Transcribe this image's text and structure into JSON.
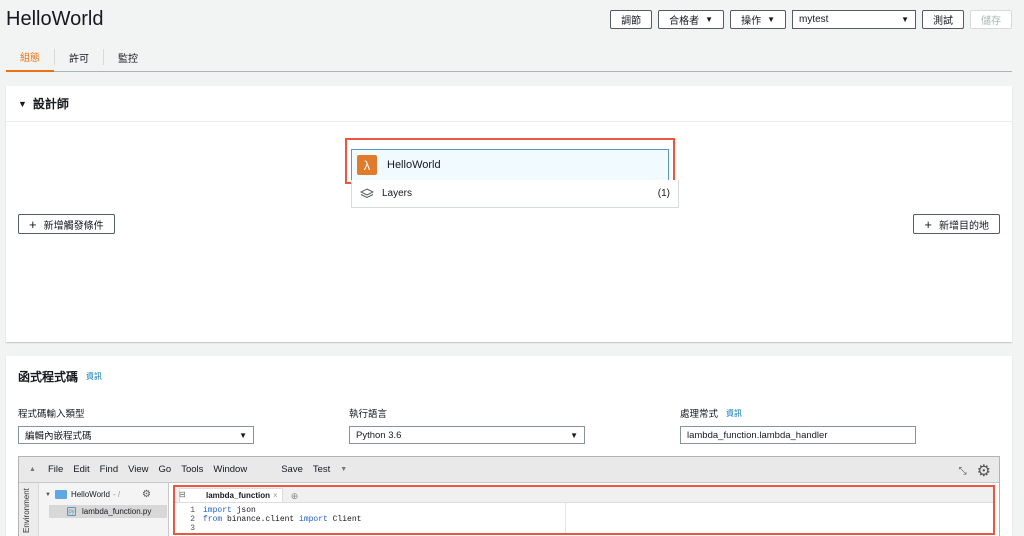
{
  "page": {
    "title": "HelloWorld"
  },
  "top_actions": {
    "throttle": "調節",
    "qualifiers": "合格者",
    "actions": "操作",
    "test_event_select": "mytest",
    "test": "測試",
    "save": "儲存"
  },
  "tabs": [
    {
      "label": "組態",
      "active": true
    },
    {
      "label": "許可",
      "active": false
    },
    {
      "label": "監控",
      "active": false
    }
  ],
  "designer": {
    "header": "設計師",
    "function_name": "HelloWorld",
    "layers_label": "Layers",
    "layers_count": "(1)",
    "add_trigger": "新增觸發條件",
    "add_destination": "新增目的地"
  },
  "function_code": {
    "header": "函式程式碼",
    "info_link": "資訊",
    "entry_type_label": "程式碼輸入類型",
    "entry_type_value": "編輯內嵌程式碼",
    "runtime_label": "執行語言",
    "runtime_value": "Python 3.6",
    "handler_label": "處理常式",
    "handler_info": "資訊",
    "handler_value": "lambda_function.lambda_handler"
  },
  "ide": {
    "menu": [
      "File",
      "Edit",
      "Find",
      "View",
      "Go",
      "Tools",
      "Window"
    ],
    "save": "Save",
    "test": "Test",
    "environment_tab": "Environment",
    "folder_name": "HelloWorld",
    "folder_suffix": "- /",
    "file_name": "lambda_function.py",
    "editor_tab": "lambda_function",
    "code_lines": [
      {
        "num": "1",
        "kw": "import",
        "rest": " json"
      },
      {
        "num": "2",
        "kw": "from",
        "mid": " binance.client ",
        "kw2": "import",
        "rest": " Client"
      },
      {
        "num": "3",
        "kw": "",
        "rest": ""
      }
    ]
  },
  "colors": {
    "accent_orange": "#ec7211",
    "highlight_red": "#e9573f",
    "link_blue": "#0073bb",
    "lambda_orange": "#e07b2c"
  }
}
